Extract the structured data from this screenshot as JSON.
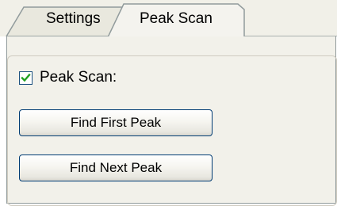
{
  "tabs": [
    {
      "label": "Settings",
      "active": false
    },
    {
      "label": "Peak Scan",
      "active": true
    }
  ],
  "peak_scan": {
    "checkbox_label": "Peak Scan:",
    "checked": true,
    "find_first_label": "Find First Peak",
    "find_next_label": "Find Next Peak"
  },
  "colors": {
    "tab_border": "#919b9c",
    "active_tab_accent": "#ffc83c",
    "checkmark": "#21a121",
    "button_border": "#003c74",
    "panel_background": "#f2f1ea"
  }
}
